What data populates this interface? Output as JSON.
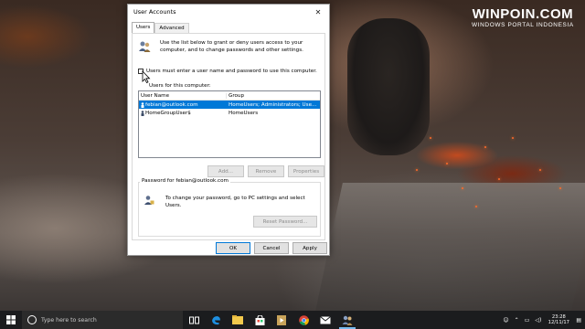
{
  "watermark": {
    "main": "WINPOIN.COM",
    "sub": "WINDOWS PORTAL INDONESIA"
  },
  "dialog": {
    "title": "User Accounts",
    "tabs": [
      {
        "label": "Users",
        "active": true
      },
      {
        "label": "Advanced",
        "active": false
      }
    ],
    "intro": "Use the list below to grant or deny users access to your computer, and to change passwords and other settings.",
    "require_login": {
      "label": "Users must enter a user name and password to use this computer.",
      "checked": false
    },
    "users_label": "Users for this computer:",
    "columns": [
      "User Name",
      "Group"
    ],
    "users": [
      {
        "name": "febian@outlook.com",
        "group": "HomeUsers; Administrators; Use...",
        "selected": true
      },
      {
        "name": "HomeGroupUser$",
        "group": "HomeUsers",
        "selected": false
      }
    ],
    "buttons": {
      "add": "Add...",
      "remove": "Remove",
      "properties": "Properties"
    },
    "password_group": {
      "legend": "Password for febian@outlook.com",
      "text": "To change your password, go to PC settings and select Users.",
      "reset_button": "Reset Password..."
    },
    "footer": {
      "ok": "OK",
      "cancel": "Cancel",
      "apply": "Apply"
    }
  },
  "taskbar": {
    "search_placeholder": "Type here to search",
    "pinned": [
      "task-view-icon",
      "edge-icon",
      "file-explorer-icon",
      "store-icon",
      "media-icon",
      "chrome-icon",
      "mail-icon",
      "user-accounts-icon"
    ],
    "clock": {
      "time": "23:28",
      "date": "12/11/17"
    }
  },
  "colors": {
    "selection": "#0078d7",
    "taskbar": "#1b1c1e",
    "accent_underline": "#76b9ed"
  }
}
